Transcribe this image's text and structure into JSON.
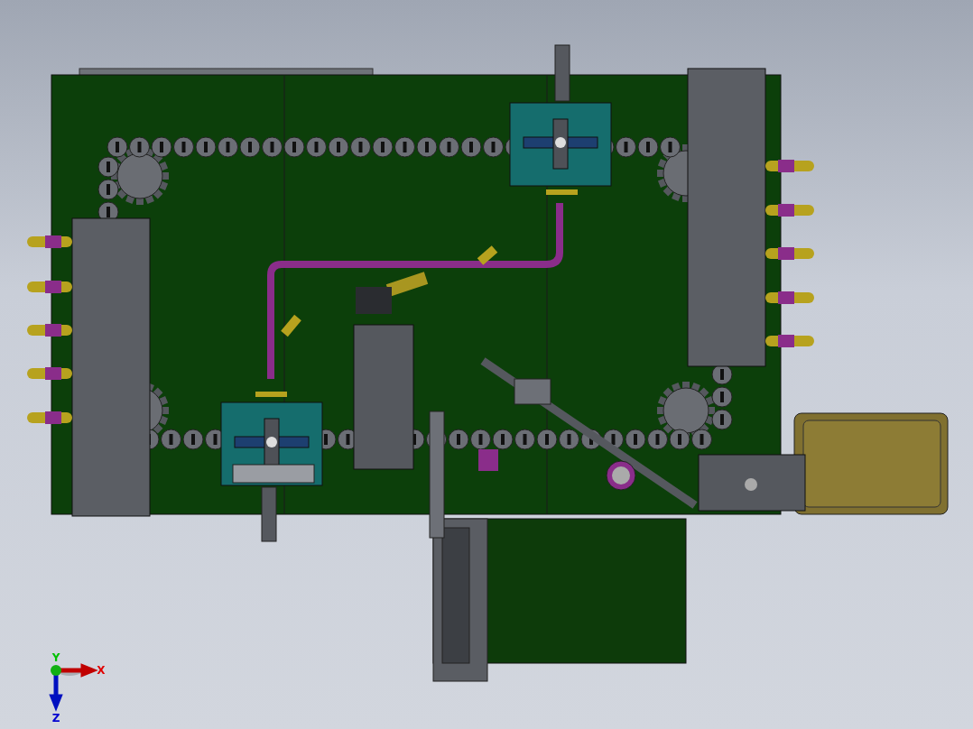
{
  "viewport": {
    "axis_labels": [
      {
        "label": "Y",
        "color": "#00c000"
      },
      {
        "label": "X",
        "color": "#e00000"
      },
      {
        "label": "Z",
        "color": "#0000d0"
      }
    ]
  }
}
